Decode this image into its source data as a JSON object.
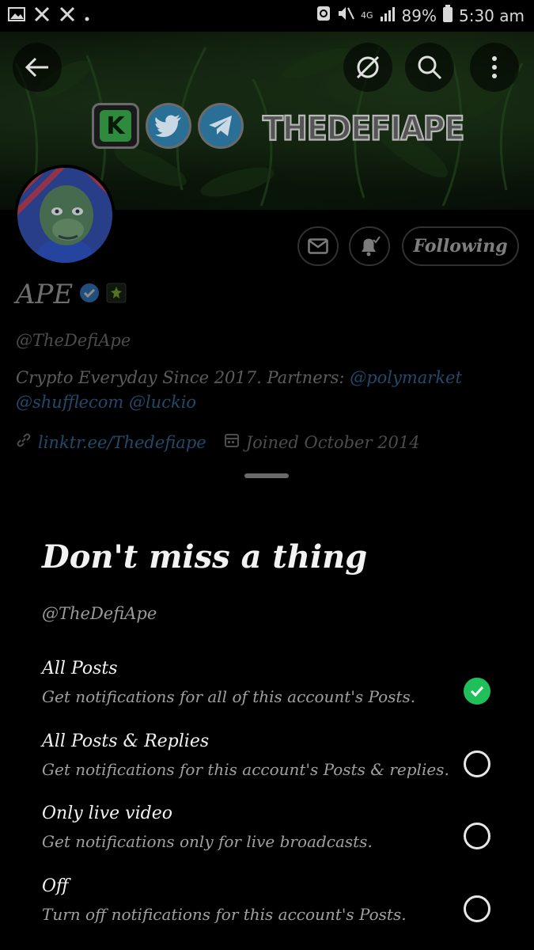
{
  "status_bar": {
    "network": "4G",
    "battery": "89%",
    "time": "5:30 am"
  },
  "banner": {
    "brand_text": "THEDEFIAPE",
    "badges": [
      "kick-logo-icon",
      "twitter-logo-icon",
      "telegram-logo-icon"
    ]
  },
  "profile": {
    "name": "APE",
    "handle": "@TheDefiApe",
    "bio_text": "Crypto Everyday Since 2017. Partners: ",
    "bio_mention_1": "@polymarket",
    "bio_mention_2": "@shufflecom",
    "bio_mention_3": "@luckio",
    "link": "linktr.ee/Thedefiape",
    "joined": "Joined October 2014",
    "following_label": "Following"
  },
  "sheet": {
    "title": "Don't miss a thing",
    "handle": "@TheDefiApe",
    "options": [
      {
        "title": "All Posts",
        "subtitle": "Get notifications for all of this account's Posts.",
        "selected": true
      },
      {
        "title": "All Posts & Replies",
        "subtitle": "Get notifications for this account's Posts & replies.",
        "selected": false
      },
      {
        "title": "Only live video",
        "subtitle": "Get notifications only for live broadcasts.",
        "selected": false
      },
      {
        "title": "Off",
        "subtitle": "Turn off notifications for this account's Posts.",
        "selected": false
      }
    ]
  },
  "colors": {
    "accent_link": "#3f85c0",
    "selected_green": "#1fbf5a",
    "background": "#000000"
  }
}
